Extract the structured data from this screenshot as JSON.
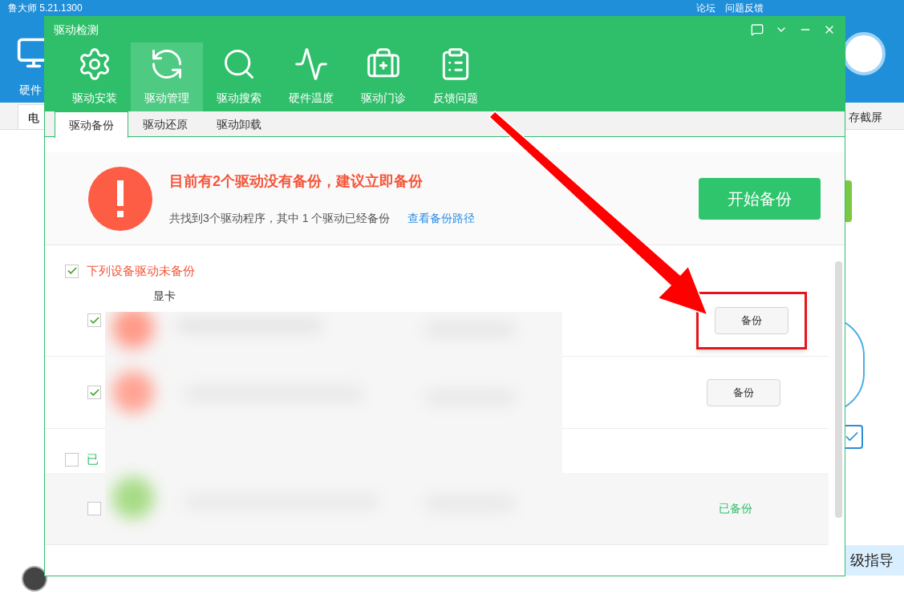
{
  "background_app": {
    "title": "鲁大师 5.21.1300",
    "links": [
      "论坛",
      "问题反馈"
    ],
    "side_label": "硬件",
    "tab_label": "电",
    "right_tab": "存截屏",
    "bottom_button": "级指导",
    "option_checked": true
  },
  "dialog": {
    "title": "驱动检测",
    "nav": [
      {
        "label": "驱动安装",
        "selected": false
      },
      {
        "label": "驱动管理",
        "selected": true
      },
      {
        "label": "驱动搜索",
        "selected": false
      },
      {
        "label": "硬件温度",
        "selected": false
      },
      {
        "label": "驱动门诊",
        "selected": false
      },
      {
        "label": "反馈问题",
        "selected": false
      }
    ],
    "subtabs": [
      {
        "label": "驱动备份",
        "selected": true
      },
      {
        "label": "驱动还原",
        "selected": false
      },
      {
        "label": "驱动卸载",
        "selected": false
      }
    ],
    "alert": {
      "heading": "目前有2个驱动没有备份，建议立即备份",
      "detail": "共找到3个驱动程序，其中 1 个驱动已经备份",
      "link": "查看备份路径",
      "button": "开始备份"
    },
    "groups": [
      {
        "kind": "pending",
        "title": "下列设备驱动未备份",
        "checked": true,
        "rows": [
          {
            "name": "显卡",
            "checked": true,
            "action": "备份",
            "highlighted": true
          },
          {
            "checked": true,
            "action": "备份",
            "highlighted": false
          }
        ]
      },
      {
        "kind": "done",
        "title": "已",
        "checked": false,
        "rows": [
          {
            "checked": false,
            "status": "已备份"
          }
        ]
      }
    ]
  }
}
